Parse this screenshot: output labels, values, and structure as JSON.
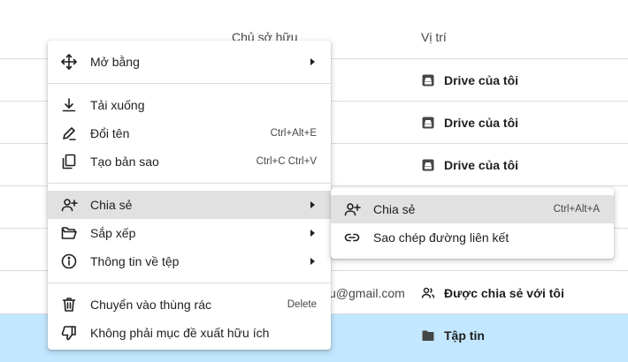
{
  "columns": {
    "owner": "Chủ sở hữu",
    "location": "Vị trí"
  },
  "rows": [
    {
      "location": "Drive của tôi",
      "location_icon": "my-drive-icon",
      "owner": ""
    },
    {
      "location": "Drive của tôi",
      "location_icon": "my-drive-icon",
      "owner": ""
    },
    {
      "location": "Drive của tôi",
      "location_icon": "my-drive-icon",
      "owner": ""
    },
    {
      "location": "",
      "owner": ""
    },
    {
      "location": "",
      "owner": ""
    },
    {
      "location": "Được chia sẻ với tôi",
      "location_icon": "shared-with-me-icon",
      "owner": "u@gmail.com"
    },
    {
      "location": "Tập tin",
      "location_icon": "folder-icon",
      "owner": "",
      "selected": true
    }
  ],
  "context_menu": {
    "open_with": "Mở bằng",
    "download": "Tải xuống",
    "rename": "Đổi tên",
    "rename_shortcut": "Ctrl+Alt+E",
    "make_copy": "Tạo bản sao",
    "make_copy_shortcut": "Ctrl+C Ctrl+V",
    "share": "Chia sẻ",
    "organize": "Sắp xếp",
    "file_info": "Thông tin về tệp",
    "move_to_trash": "Chuyển vào thùng rác",
    "move_to_trash_shortcut": "Delete",
    "not_helpful": "Không phải mục đề xuất hữu ích"
  },
  "share_submenu": {
    "share": "Chia sẻ",
    "share_shortcut": "Ctrl+Alt+A",
    "copy_link": "Sao chép đường liên kết"
  },
  "colors": {
    "selected_row": "#c2e7ff",
    "hover_item": "#e1e1e1",
    "divider": "#dadce0"
  }
}
